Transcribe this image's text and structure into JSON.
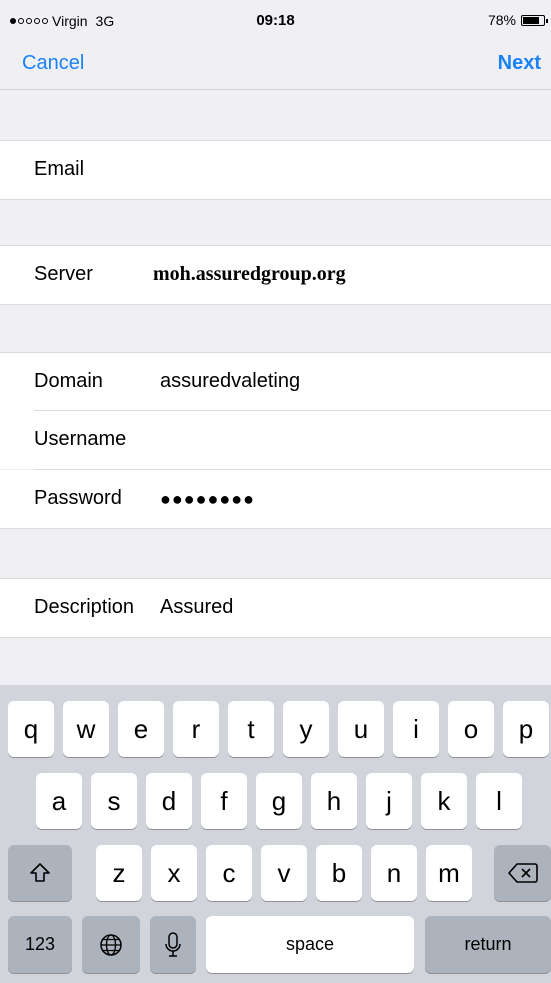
{
  "status_bar": {
    "carrier": "Virgin",
    "network": "3G",
    "time": "09:18",
    "battery_percent": "78%",
    "battery_level": 0.78,
    "signal_bars_filled": 1,
    "signal_bars_total": 5
  },
  "nav": {
    "cancel_label": "Cancel",
    "next_label": "Next",
    "accent_color": "#1a82f7"
  },
  "form": {
    "email": {
      "label": "Email",
      "value": ""
    },
    "server": {
      "label": "Server",
      "value": "moh.assuredgroup.org"
    },
    "domain": {
      "label": "Domain",
      "value": "assuredvaleting"
    },
    "username": {
      "label": "Username",
      "value": ""
    },
    "password": {
      "label": "Password",
      "value": "●●●●●●●●"
    },
    "description": {
      "label": "Description",
      "value": "Assured"
    }
  },
  "keyboard": {
    "row1": [
      "q",
      "w",
      "e",
      "r",
      "t",
      "y",
      "u",
      "i",
      "o",
      "p"
    ],
    "row2": [
      "a",
      "s",
      "d",
      "f",
      "g",
      "h",
      "j",
      "k",
      "l"
    ],
    "row3": [
      "z",
      "x",
      "c",
      "v",
      "b",
      "n",
      "m"
    ],
    "shift_icon": "shift-icon",
    "delete_icon": "backspace-icon",
    "numbers_label": "123",
    "globe_icon": "globe-icon",
    "mic_icon": "microphone-icon",
    "space_label": "space",
    "return_label": "return"
  }
}
